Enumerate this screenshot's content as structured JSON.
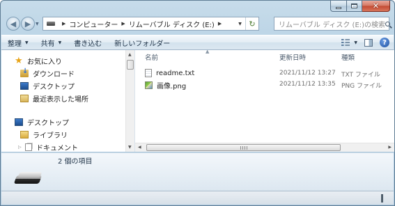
{
  "window": {
    "caption_buttons": {
      "minimize": "minimize",
      "maximize": "maximize",
      "close": "close"
    }
  },
  "address": {
    "breadcrumbs": [
      "コンピューター",
      "リムーバブル ディスク (E:)"
    ],
    "search_placeholder": "リムーバブル ディスク (E:)の検索"
  },
  "toolbar": {
    "organize": "整理",
    "share": "共有",
    "burn": "書き込む",
    "new_folder": "新しいフォルダー"
  },
  "nav": {
    "favorites": "お気に入り",
    "downloads": "ダウンロード",
    "desktop": "デスクトップ",
    "recent": "最近表示した場所",
    "desktop_root": "デスクトップ",
    "libraries": "ライブラリ",
    "documents": "ドキュメント"
  },
  "columns": {
    "name": "名前",
    "date": "更新日時",
    "type": "種類"
  },
  "files": [
    {
      "name": "readme.txt",
      "date": "2021/11/12 13:27",
      "type": "TXT ファイル",
      "icon": "text-file-icon"
    },
    {
      "name": "画像.png",
      "date": "2021/11/12 13:35",
      "type": "PNG ファイル",
      "icon": "image-file-icon"
    }
  ],
  "details": {
    "item_count": "2 個の項目"
  }
}
